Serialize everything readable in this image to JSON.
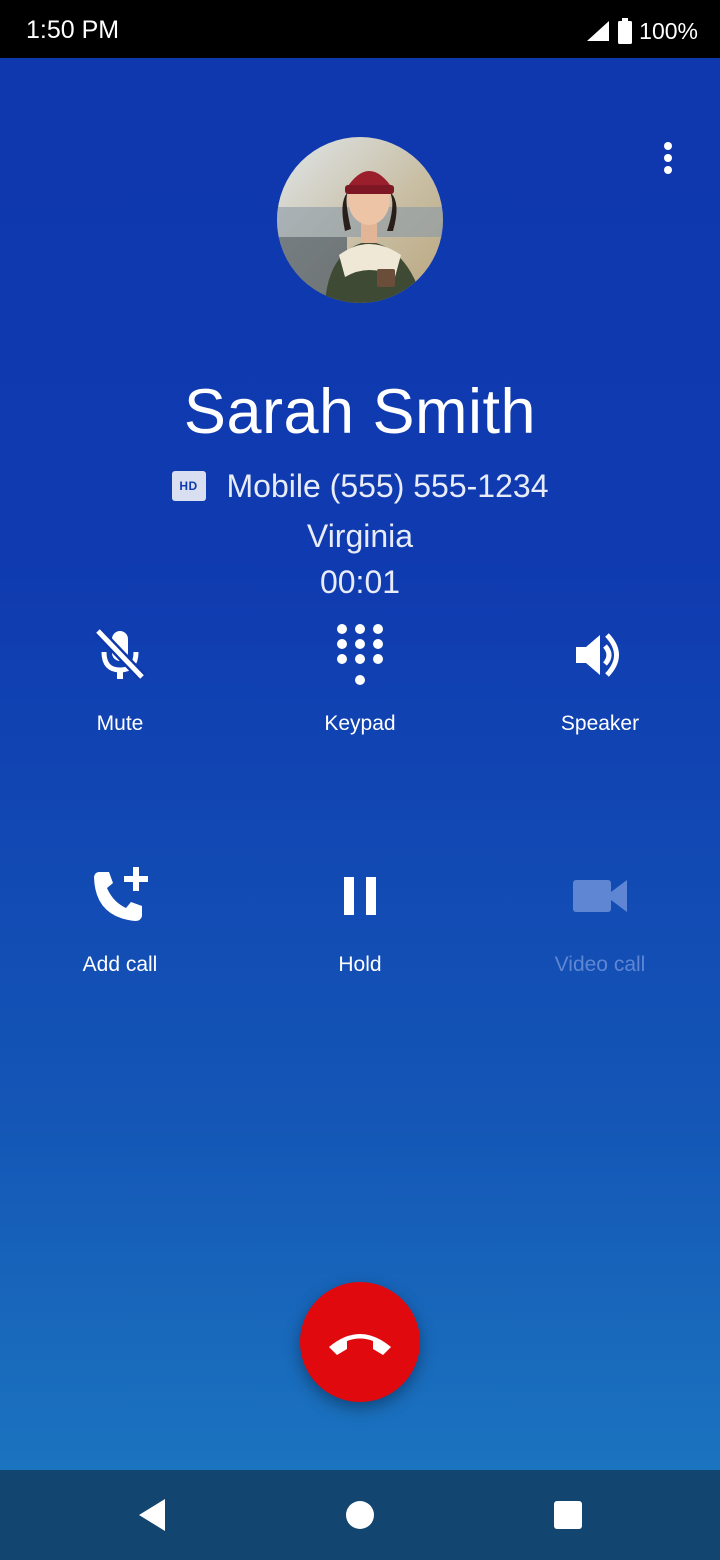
{
  "status_bar": {
    "time": "1:50 PM",
    "battery_text": "100%",
    "icons": [
      "signal-icon",
      "battery-icon"
    ]
  },
  "call": {
    "caller_name": "Sarah Smith",
    "hd_badge": "HD",
    "line_info": "Mobile (555) 555-1234",
    "location": "Virginia",
    "timer": "00:01"
  },
  "controls": [
    {
      "label": "Mute",
      "icon": "mic-off-icon",
      "enabled": true
    },
    {
      "label": "Keypad",
      "icon": "dialpad-icon",
      "enabled": true
    },
    {
      "label": "Speaker",
      "icon": "speaker-icon",
      "enabled": true
    },
    {
      "label": "Add call",
      "icon": "add-call-icon",
      "enabled": true
    },
    {
      "label": "Hold",
      "icon": "pause-icon",
      "enabled": true
    },
    {
      "label": "Video call",
      "icon": "videocam-icon",
      "enabled": false
    }
  ],
  "navigation": {
    "icons": [
      "back-icon",
      "home-icon",
      "recents-icon"
    ]
  },
  "colors": {
    "background": "#0f38ae",
    "end_call": "#e00a0e",
    "nav_bar": "#12456f",
    "disabled": "#5f86d2"
  }
}
